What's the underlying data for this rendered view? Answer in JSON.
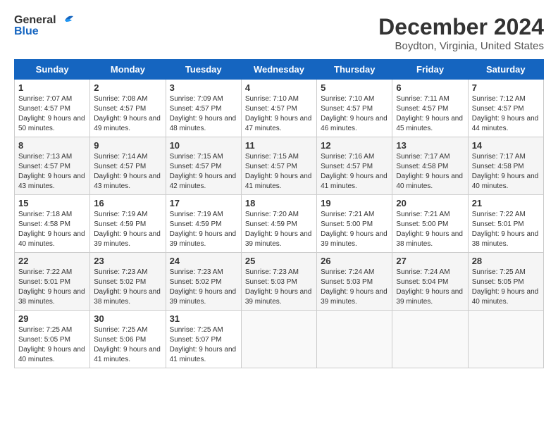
{
  "header": {
    "logo_general": "General",
    "logo_blue": "Blue",
    "title": "December 2024",
    "subtitle": "Boydton, Virginia, United States"
  },
  "calendar": {
    "days_of_week": [
      "Sunday",
      "Monday",
      "Tuesday",
      "Wednesday",
      "Thursday",
      "Friday",
      "Saturday"
    ],
    "weeks": [
      [
        {
          "day": "1",
          "sunrise": "7:07 AM",
          "sunset": "4:57 PM",
          "daylight": "9 hours and 50 minutes."
        },
        {
          "day": "2",
          "sunrise": "7:08 AM",
          "sunset": "4:57 PM",
          "daylight": "9 hours and 49 minutes."
        },
        {
          "day": "3",
          "sunrise": "7:09 AM",
          "sunset": "4:57 PM",
          "daylight": "9 hours and 48 minutes."
        },
        {
          "day": "4",
          "sunrise": "7:10 AM",
          "sunset": "4:57 PM",
          "daylight": "9 hours and 47 minutes."
        },
        {
          "day": "5",
          "sunrise": "7:10 AM",
          "sunset": "4:57 PM",
          "daylight": "9 hours and 46 minutes."
        },
        {
          "day": "6",
          "sunrise": "7:11 AM",
          "sunset": "4:57 PM",
          "daylight": "9 hours and 45 minutes."
        },
        {
          "day": "7",
          "sunrise": "7:12 AM",
          "sunset": "4:57 PM",
          "daylight": "9 hours and 44 minutes."
        }
      ],
      [
        {
          "day": "8",
          "sunrise": "7:13 AM",
          "sunset": "4:57 PM",
          "daylight": "9 hours and 43 minutes."
        },
        {
          "day": "9",
          "sunrise": "7:14 AM",
          "sunset": "4:57 PM",
          "daylight": "9 hours and 43 minutes."
        },
        {
          "day": "10",
          "sunrise": "7:15 AM",
          "sunset": "4:57 PM",
          "daylight": "9 hours and 42 minutes."
        },
        {
          "day": "11",
          "sunrise": "7:15 AM",
          "sunset": "4:57 PM",
          "daylight": "9 hours and 41 minutes."
        },
        {
          "day": "12",
          "sunrise": "7:16 AM",
          "sunset": "4:57 PM",
          "daylight": "9 hours and 41 minutes."
        },
        {
          "day": "13",
          "sunrise": "7:17 AM",
          "sunset": "4:58 PM",
          "daylight": "9 hours and 40 minutes."
        },
        {
          "day": "14",
          "sunrise": "7:17 AM",
          "sunset": "4:58 PM",
          "daylight": "9 hours and 40 minutes."
        }
      ],
      [
        {
          "day": "15",
          "sunrise": "7:18 AM",
          "sunset": "4:58 PM",
          "daylight": "9 hours and 40 minutes."
        },
        {
          "day": "16",
          "sunrise": "7:19 AM",
          "sunset": "4:59 PM",
          "daylight": "9 hours and 39 minutes."
        },
        {
          "day": "17",
          "sunrise": "7:19 AM",
          "sunset": "4:59 PM",
          "daylight": "9 hours and 39 minutes."
        },
        {
          "day": "18",
          "sunrise": "7:20 AM",
          "sunset": "4:59 PM",
          "daylight": "9 hours and 39 minutes."
        },
        {
          "day": "19",
          "sunrise": "7:21 AM",
          "sunset": "5:00 PM",
          "daylight": "9 hours and 39 minutes."
        },
        {
          "day": "20",
          "sunrise": "7:21 AM",
          "sunset": "5:00 PM",
          "daylight": "9 hours and 38 minutes."
        },
        {
          "day": "21",
          "sunrise": "7:22 AM",
          "sunset": "5:01 PM",
          "daylight": "9 hours and 38 minutes."
        }
      ],
      [
        {
          "day": "22",
          "sunrise": "7:22 AM",
          "sunset": "5:01 PM",
          "daylight": "9 hours and 38 minutes."
        },
        {
          "day": "23",
          "sunrise": "7:23 AM",
          "sunset": "5:02 PM",
          "daylight": "9 hours and 38 minutes."
        },
        {
          "day": "24",
          "sunrise": "7:23 AM",
          "sunset": "5:02 PM",
          "daylight": "9 hours and 39 minutes."
        },
        {
          "day": "25",
          "sunrise": "7:23 AM",
          "sunset": "5:03 PM",
          "daylight": "9 hours and 39 minutes."
        },
        {
          "day": "26",
          "sunrise": "7:24 AM",
          "sunset": "5:03 PM",
          "daylight": "9 hours and 39 minutes."
        },
        {
          "day": "27",
          "sunrise": "7:24 AM",
          "sunset": "5:04 PM",
          "daylight": "9 hours and 39 minutes."
        },
        {
          "day": "28",
          "sunrise": "7:25 AM",
          "sunset": "5:05 PM",
          "daylight": "9 hours and 40 minutes."
        }
      ],
      [
        {
          "day": "29",
          "sunrise": "7:25 AM",
          "sunset": "5:05 PM",
          "daylight": "9 hours and 40 minutes."
        },
        {
          "day": "30",
          "sunrise": "7:25 AM",
          "sunset": "5:06 PM",
          "daylight": "9 hours and 41 minutes."
        },
        {
          "day": "31",
          "sunrise": "7:25 AM",
          "sunset": "5:07 PM",
          "daylight": "9 hours and 41 minutes."
        },
        null,
        null,
        null,
        null
      ]
    ]
  }
}
